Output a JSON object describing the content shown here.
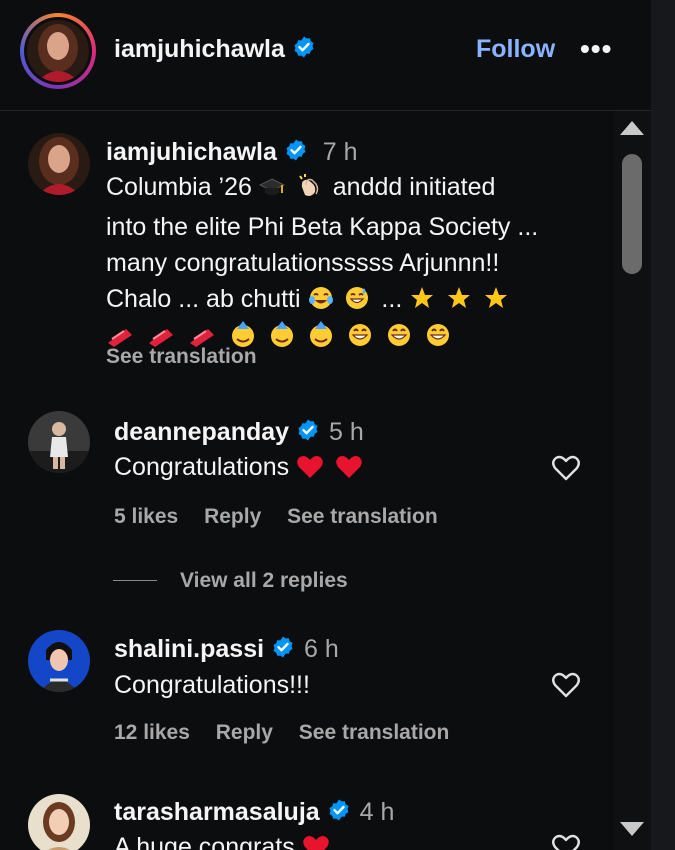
{
  "post": {
    "username": "iamjuhichawla",
    "follow_label": "Follow",
    "more_label": "•••"
  },
  "caption": {
    "username": "iamjuhichawla",
    "time": "7 h",
    "line1_text": "Columbia ’26",
    "line1_text_after": "anddd initiated",
    "line2": "into the elite Phi Beta Kappa Society ...",
    "line3": "many congratulationsssss Arjunnn!!",
    "line4_text": "Chalo ... ab chutti",
    "line4_ellipsis": "...",
    "see_translation": "See translation"
  },
  "comments": [
    {
      "username": "deannepanday",
      "time": "5 h",
      "text": "Congratulations",
      "likes": "5 likes",
      "reply": "Reply",
      "see_translation": "See translation"
    },
    {
      "username": "shalini.passi",
      "time": "6 h",
      "text": "Congratulations!!!",
      "likes": "12 likes",
      "reply": "Reply",
      "see_translation": "See translation"
    },
    {
      "username": "tarasharmasaluja",
      "time": "4 h",
      "text": "A huge congrats"
    }
  ],
  "view_replies": "View all 2 replies",
  "icons": {
    "verified": "verified-badge-icon",
    "heart": "heart-outline-icon",
    "accent_blue": "#0095f6",
    "follow_blue": "#8ab4ff"
  }
}
